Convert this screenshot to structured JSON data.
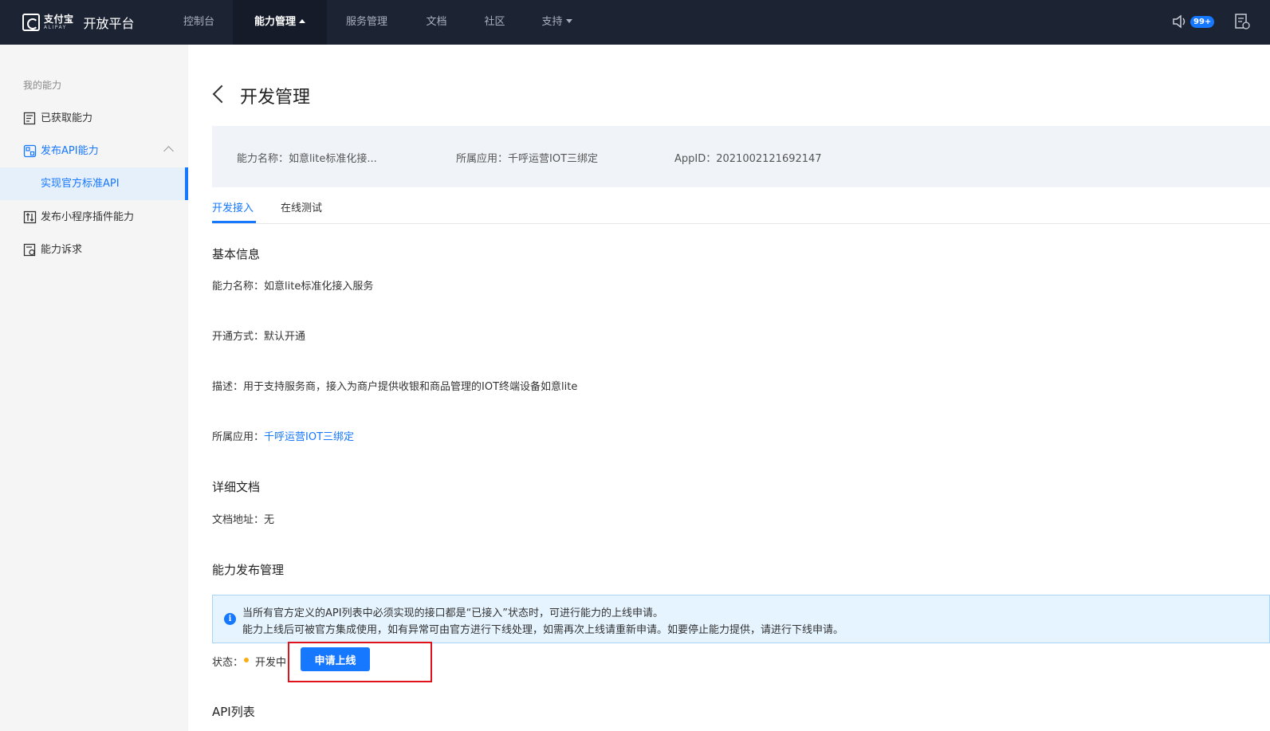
{
  "topnav": {
    "logo_cn": "支付宝",
    "logo_en": "ALIPAY",
    "platform_title": "开放平台",
    "items": [
      {
        "label": "控制台"
      },
      {
        "label": "能力管理"
      },
      {
        "label": "服务管理"
      },
      {
        "label": "文档"
      },
      {
        "label": "社区"
      },
      {
        "label": "支持"
      }
    ],
    "notification_badge": "99+",
    "icons": [
      "speaker-icon",
      "document-icon"
    ]
  },
  "sidebar": {
    "section_title": "我的能力",
    "items": [
      {
        "label": "已获取能力",
        "icon": "document-list-icon"
      },
      {
        "label": "发布API能力",
        "icon": "api-icon"
      },
      {
        "label": "实现官方标准API"
      },
      {
        "label": "发布小程序插件能力",
        "icon": "plugin-icon"
      },
      {
        "label": "能力诉求",
        "icon": "request-icon"
      }
    ]
  },
  "main": {
    "page_title": "开发管理",
    "info_bar": {
      "ability_name": "能力名称：如意lite标准化接...",
      "app": "所属应用：千呼运营IOT三绑定",
      "appid": "AppID：2021002121692147"
    },
    "tabs": [
      {
        "label": "开发接入"
      },
      {
        "label": "在线测试"
      }
    ],
    "basic_info": {
      "title": "基本信息",
      "ability_name_label": "能力名称：",
      "ability_name_value": "如意lite标准化接入服务",
      "open_mode_label": "开通方式：",
      "open_mode_value": "默认开通",
      "desc_label": "描述：",
      "desc_value": "用于支持服务商，接入为商户提供收银和商品管理的IOT终端设备如意lite",
      "app_label": "所属应用：",
      "app_value": "千呼运营IOT三绑定"
    },
    "docs": {
      "title": "详细文档",
      "address_label": "文档地址：",
      "address_value": "无"
    },
    "publish": {
      "title": "能力发布管理",
      "alert_line1": "当所有官方定义的API列表中必须实现的接口都是“已接入”状态时，可进行能力的上线申请。",
      "alert_line2": "能力上线后可被官方集成使用，如有异常可由官方进行下线处理，如需再次上线请重新申请。如要停止能力提供，请进行下线申请。",
      "status_label": "状态：",
      "status_value": "开发中",
      "status_color": "#faad14",
      "apply_button": "申请上线"
    },
    "api_list_title": "API列表"
  },
  "colors": {
    "nav_bg": "#1c2333",
    "accent": "#1677ff",
    "highlight": "#e0121b"
  }
}
